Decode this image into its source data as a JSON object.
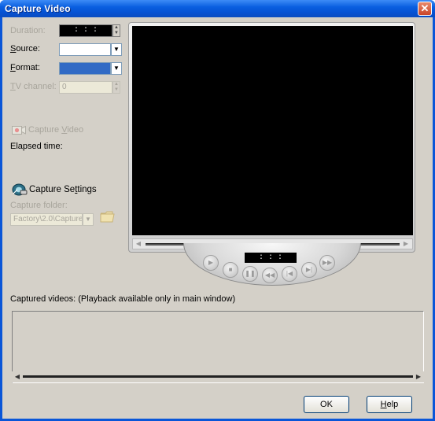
{
  "window": {
    "title": "Capture Video",
    "close_glyph": "✕"
  },
  "left_panel": {
    "duration_label": "Duration:",
    "duration_value": ": : :",
    "source_label_pre": "",
    "source_label_ul": "S",
    "source_label_post": "ource:",
    "format_label_ul": "F",
    "format_label_post": "ormat:",
    "tv_channel_label_ul": "T",
    "tv_channel_label_post": "V channel:",
    "tv_channel_value": "0",
    "capture_video_label_pre": "Capture ",
    "capture_video_label_ul": "V",
    "capture_video_label_post": "ideo",
    "elapsed_label": "Elapsed time:",
    "capture_settings_label_pre": "Capture Se",
    "capture_settings_label_ul": "t",
    "capture_settings_label_post": "tings",
    "capture_folder_label": "Capture folder:",
    "capture_folder_value": "Factory\\2.0\\Capture"
  },
  "player": {
    "time_value": ": : :"
  },
  "captured": {
    "label": "Captured videos: (Playback available only in main window)"
  },
  "buttons": {
    "ok": "OK",
    "help_ul": "H",
    "help_post": "elp"
  },
  "icons": {
    "camera": "record-camera-icon",
    "settings": "capture-settings-icon",
    "folder": "folder-icon"
  },
  "colors": {
    "title_bar": "#0a5fe0",
    "dialog_bg": "#d4d0c8",
    "video_bg": "#000000",
    "selection": "#316ac5"
  }
}
